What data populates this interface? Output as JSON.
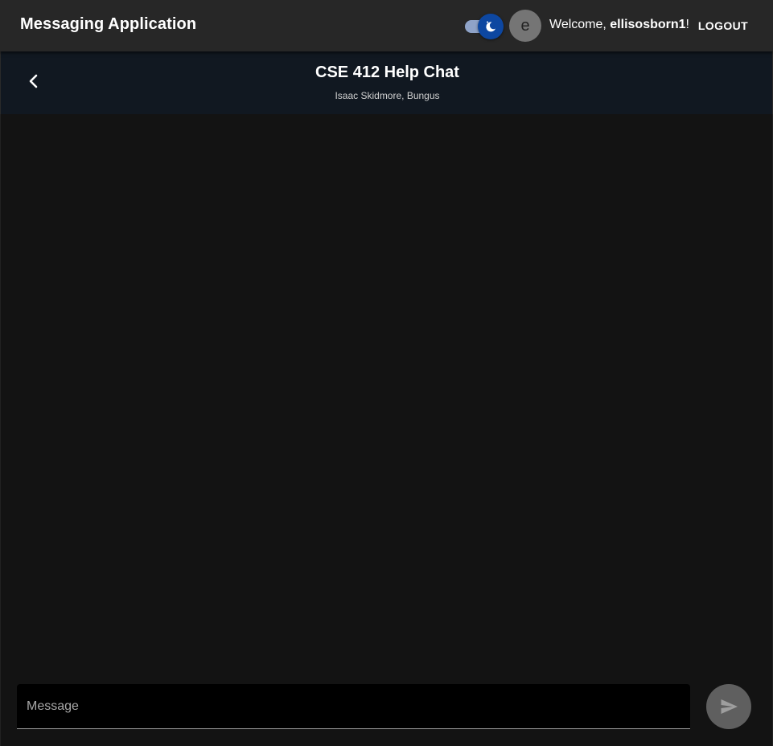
{
  "appbar": {
    "title": "Messaging Application",
    "avatar_initial": "e",
    "welcome_prefix": "Welcome, ",
    "username": "ellisosborn1",
    "welcome_suffix": "!",
    "logout_label": "LOGOUT",
    "theme_toggle": {
      "icon": "moon-icon",
      "state": "dark"
    }
  },
  "chat": {
    "title": "CSE 412 Help Chat",
    "members": "Isaac Skidmore, Bungus",
    "back_icon": "chevron-left-icon"
  },
  "composer": {
    "placeholder": "Message",
    "value": "",
    "send_icon": "send-icon"
  },
  "colors": {
    "appbar": "#272727",
    "chat_header": "#111821",
    "background": "#131313",
    "switch_thumb": "#0d47a1",
    "switch_track": "#8fa3c8",
    "avatar": "#757575",
    "send_button": "#5f5f5f"
  }
}
